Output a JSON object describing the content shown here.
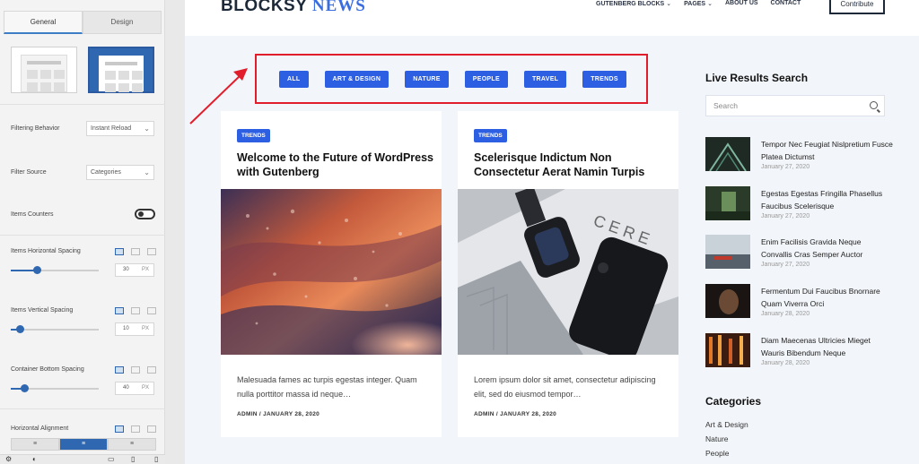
{
  "editor": {
    "tabs": [
      {
        "label": "General"
      },
      {
        "label": "Design"
      }
    ],
    "filtering_behavior": {
      "label": "Filtering Behavior",
      "value": "Instant Reload"
    },
    "filter_source": {
      "label": "Filter Source",
      "value": "Categories"
    },
    "items_counters": {
      "label": "Items Counters",
      "enabled": true
    },
    "h_spacing": {
      "label": "Items Horizontal Spacing",
      "value": "30",
      "unit": "PX",
      "fraction": 0.3
    },
    "v_spacing": {
      "label": "Items Vertical Spacing",
      "value": "10",
      "unit": "PX",
      "fraction": 0.1
    },
    "bottom_spacing": {
      "label": "Container Bottom Spacing",
      "value": "40",
      "unit": "PX",
      "fraction": 0.15
    },
    "alignment": {
      "label": "Horizontal Alignment",
      "options": [
        "≡",
        "≡",
        "≡"
      ],
      "selected": 1
    }
  },
  "site": {
    "logo_main": "BLOCKSY",
    "logo_accent": "NEWS",
    "nav": [
      {
        "label": "GUTENBERG BLOCKS",
        "has_dropdown": true
      },
      {
        "label": "PAGES",
        "has_dropdown": true
      },
      {
        "label": "ABOUT US",
        "has_dropdown": false
      },
      {
        "label": "CONTACT",
        "has_dropdown": false
      }
    ],
    "cta": "Contribute",
    "accent_color": "#2d5fe3",
    "highlight_color": "#e21d2b"
  },
  "filters": [
    "ALL",
    "ART & DESIGN",
    "NATURE",
    "PEOPLE",
    "TRAVEL",
    "TRENDS"
  ],
  "cards": [
    {
      "tag": "TRENDS",
      "title": "Welcome to the Future of WordPress with Gutenberg",
      "excerpt": "Malesuada fames ac turpis egestas integer. Quam nulla porttitor massa id neque…",
      "meta": "ADMIN  /  JANUARY 28, 2020"
    },
    {
      "tag": "TRENDS",
      "title": "Scelerisque Indictum Non Consectetur Aerat Namin Turpis",
      "excerpt": "Lorem ipsum dolor sit amet, consectetur adipiscing elit, sed do eiusmod tempor…",
      "meta": "ADMIN  /  JANUARY 28, 2020"
    }
  ],
  "sidebar": {
    "search_title": "Live Results Search",
    "search_placeholder": "Search",
    "posts": [
      {
        "title": "Tempor Nec Feugiat Nislpretium Fusce Platea Dictumst",
        "date": "January 27, 2020"
      },
      {
        "title": "Egestas Egestas Fringilla Phasellus Faucibus Scelerisque",
        "date": "January 27, 2020"
      },
      {
        "title": "Enim Facilisis Gravida Neque Convallis Cras Semper Auctor",
        "date": "January 27, 2020"
      },
      {
        "title": "Fermentum Dui Faucibus Bnornare Quam Viverra Orci",
        "date": "January 28, 2020"
      },
      {
        "title": "Diam Maecenas Ultricies Mieget Wauris Bibendum Neque",
        "date": "January 28, 2020"
      }
    ],
    "categories_title": "Categories",
    "categories": [
      "Art & Design",
      "Nature",
      "People"
    ]
  }
}
